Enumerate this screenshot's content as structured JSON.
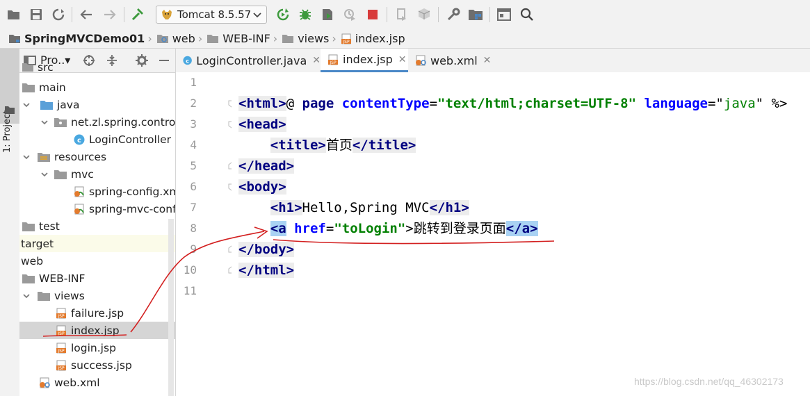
{
  "toolbar": {
    "run_config": "Tomcat 8.5.57",
    "icons": [
      "open-icon",
      "save-icon",
      "sync-icon",
      "back-icon",
      "forward-icon",
      "build-icon",
      "rerun-icon",
      "debug-icon",
      "coverage-icon",
      "profile-icon",
      "stop-icon",
      "attach-icon",
      "deploy-icon",
      "settings-icon",
      "project-structure-icon",
      "terminal-icon",
      "search-icon"
    ]
  },
  "breadcrumb": {
    "project": "SpringMVCDemo01",
    "items": [
      "web",
      "WEB-INF",
      "views",
      "index.jsp"
    ]
  },
  "side_tab": {
    "label": "1: Project"
  },
  "project_panel": {
    "title": "Pro..▾",
    "tree": [
      {
        "label": "src",
        "type": "folder"
      },
      {
        "label": "main",
        "type": "folder"
      },
      {
        "label": "java",
        "type": "source-folder"
      },
      {
        "label": "net.zl.spring.controll",
        "type": "package"
      },
      {
        "label": "LoginController",
        "type": "class"
      },
      {
        "label": "resources",
        "type": "resource-folder"
      },
      {
        "label": "mvc",
        "type": "folder"
      },
      {
        "label": "spring-config.xm",
        "type": "xml"
      },
      {
        "label": "spring-mvc-confi",
        "type": "xml"
      },
      {
        "label": "test",
        "type": "folder"
      },
      {
        "label": "target",
        "type": "plain"
      },
      {
        "label": "web",
        "type": "plain"
      },
      {
        "label": "WEB-INF",
        "type": "folder"
      },
      {
        "label": "views",
        "type": "folder"
      },
      {
        "label": "failure.jsp",
        "type": "jsp"
      },
      {
        "label": "index.jsp",
        "type": "jsp"
      },
      {
        "label": "login.jsp",
        "type": "jsp"
      },
      {
        "label": "success.jsp",
        "type": "jsp"
      },
      {
        "label": "web.xml",
        "type": "xml"
      }
    ]
  },
  "tabs": [
    {
      "label": "LoginController.java",
      "active": false
    },
    {
      "label": "index.jsp",
      "active": true
    },
    {
      "label": "web.xml",
      "active": false
    }
  ],
  "line_numbers": [
    "1",
    "2",
    "3",
    "4",
    "5",
    "6",
    "7",
    "8",
    "9",
    "10",
    "11"
  ],
  "code": {
    "l1": {
      "a": "<%@ ",
      "b": "page ",
      "c": "contentType",
      "d": "=",
      "e": "\"text/html;charset=UTF-8\"",
      "f": " ",
      "g": "language",
      "h": "=\"",
      "i": "java",
      "j": "\" %>"
    },
    "l2": "<html>",
    "l3": "<head>",
    "l4": {
      "open": "<title>",
      "text": "首页",
      "close": "</title>"
    },
    "l5": "</head>",
    "l6": "<body>",
    "l7": {
      "open": "<h1>",
      "text": "Hello,Spring MVC",
      "close": "</h1>"
    },
    "l8": {
      "a_open": "<a",
      "sp": " ",
      "href": "href",
      "eq": "=",
      "val": "\"toLogin\"",
      "gt": ">",
      "text": "跳转到登录页面",
      "a_close": "</a>"
    },
    "l9": "</body>",
    "l10": "</html>"
  },
  "watermark": "https://blog.csdn.net/qq_46302173",
  "colors": {
    "tag": "#000080",
    "attr": "#0000ff",
    "string": "#008000",
    "annotation": "#d32020"
  }
}
